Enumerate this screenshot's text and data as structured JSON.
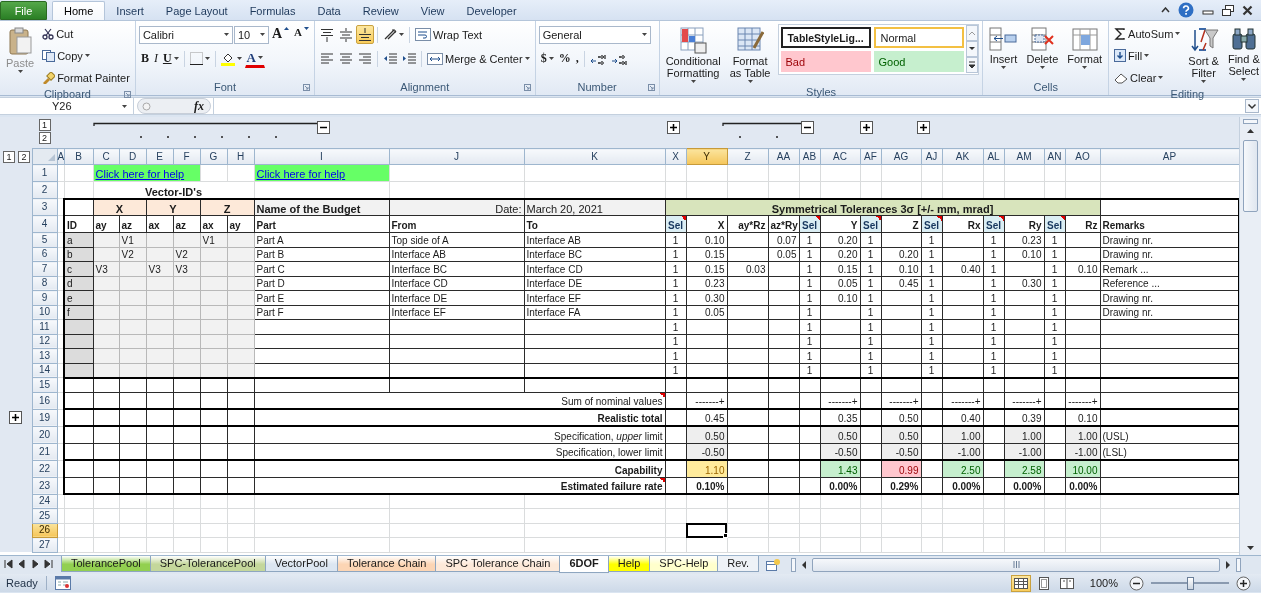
{
  "ribbon_tabs": [
    {
      "label": "File",
      "kind": "file",
      "selected": false
    },
    {
      "label": "Home",
      "kind": "tab",
      "selected": true
    },
    {
      "label": "Insert",
      "kind": "tab",
      "selected": false
    },
    {
      "label": "Page Layout",
      "kind": "tab",
      "selected": false
    },
    {
      "label": "Formulas",
      "kind": "tab",
      "selected": false
    },
    {
      "label": "Data",
      "kind": "tab",
      "selected": false
    },
    {
      "label": "Review",
      "kind": "tab",
      "selected": false
    },
    {
      "label": "View",
      "kind": "tab",
      "selected": false
    },
    {
      "label": "Developer",
      "kind": "tab",
      "selected": false
    }
  ],
  "ribbon": {
    "clipboard": {
      "label": "Clipboard",
      "paste": {
        "label": "Paste",
        "disabled": true
      },
      "cut": "Cut",
      "copy": "Copy",
      "format_painter": "Format Painter"
    },
    "font": {
      "label": "Font",
      "font_name": "Calibri",
      "font_size": "10",
      "grow": "A",
      "shrink": "A",
      "bold": "B",
      "italic": "I",
      "underline": "U",
      "font_color": "A"
    },
    "alignment": {
      "label": "Alignment",
      "vertical_align": [
        {
          "selected": false
        },
        {
          "selected": false
        },
        {
          "selected": true
        }
      ],
      "wrap_text": "Wrap Text",
      "merge_center": "Merge & Center"
    },
    "number": {
      "label": "Number",
      "format": "General",
      "currency": "$",
      "percent": "%",
      "comma": ","
    },
    "styles": {
      "label": "Styles",
      "conditional_formatting": "Conditional\nFormatting",
      "format_as_table": "Format\nas Table",
      "cell_styles": [
        {
          "text": "TableStyleLig...",
          "kind": "table"
        },
        {
          "text": "Normal",
          "kind": "normal"
        },
        {
          "text": "Bad",
          "kind": "bad"
        },
        {
          "text": "Good",
          "kind": "good"
        }
      ]
    },
    "cells": {
      "label": "Cells",
      "insert": "Insert",
      "delete": "Delete",
      "format": "Format"
    },
    "editing": {
      "label": "Editing",
      "autosum": "AutoSum",
      "fill": "Fill",
      "clear": "Clear",
      "sort_filter": "Sort &\nFilter",
      "find_select": "Find &\nSelect"
    }
  },
  "formula_bar": {
    "name_box": "Y26",
    "fx": "fx"
  },
  "outline": {
    "column_levels": [
      "1",
      "2"
    ],
    "row_levels": [
      "1",
      "2"
    ]
  },
  "columns": [
    {
      "label": "A",
      "selected": false
    },
    {
      "label": "B",
      "selected": false
    },
    {
      "label": "C",
      "selected": false
    },
    {
      "label": "D",
      "selected": false
    },
    {
      "label": "E",
      "selected": false
    },
    {
      "label": "F",
      "selected": false
    },
    {
      "label": "G",
      "selected": false
    },
    {
      "label": "H",
      "selected": false
    },
    {
      "label": "I",
      "selected": false
    },
    {
      "label": "J",
      "selected": false
    },
    {
      "label": "K",
      "selected": false
    },
    {
      "label": "X",
      "selected": false
    },
    {
      "label": "Y",
      "selected": true
    },
    {
      "label": "Z",
      "selected": false
    },
    {
      "label": "AA",
      "selected": false
    },
    {
      "label": "AB",
      "selected": false
    },
    {
      "label": "AC",
      "selected": false
    },
    {
      "label": "AF",
      "selected": false
    },
    {
      "label": "AG",
      "selected": false
    },
    {
      "label": "AJ",
      "selected": false
    },
    {
      "label": "AK",
      "selected": false
    },
    {
      "label": "AL",
      "selected": false
    },
    {
      "label": "AM",
      "selected": false
    },
    {
      "label": "AN",
      "selected": false
    },
    {
      "label": "AO",
      "selected": false
    },
    {
      "label": "AP",
      "selected": false
    }
  ],
  "rows": [
    {
      "label": "1",
      "selected": false,
      "group_collapsed": false,
      "cells": [
        {},
        {},
        {
          "kind": "link",
          "text": "Click here for help"
        },
        {
          "kind": "merged"
        },
        {
          "kind": "merged"
        },
        {
          "kind": "merged"
        },
        {},
        {},
        {
          "kind": "link",
          "text": "Click here for help"
        },
        {},
        {},
        {},
        {},
        {},
        {},
        {},
        {},
        {},
        {},
        {},
        {},
        {},
        {},
        {},
        {},
        {}
      ]
    },
    {
      "label": "2",
      "selected": false,
      "group_collapsed": false,
      "cells": [
        {},
        {},
        {
          "kind": "title",
          "text": "Vector-ID's"
        },
        {
          "kind": "merged"
        },
        {
          "kind": "merged"
        },
        {
          "kind": "merged"
        },
        {
          "kind": "merged"
        },
        {
          "kind": "merged"
        },
        {},
        {},
        {},
        {},
        {},
        {},
        {},
        {},
        {},
        {},
        {},
        {},
        {},
        {},
        {},
        {},
        {},
        {}
      ]
    },
    {
      "label": "3",
      "selected": false,
      "group_collapsed": false,
      "cells": [
        {},
        {},
        {
          "kind": "axis",
          "text": "X"
        },
        {
          "kind": "merged"
        },
        {
          "kind": "axis",
          "text": "Y"
        },
        {
          "kind": "merged"
        },
        {
          "kind": "axis",
          "text": "Z"
        },
        {
          "kind": "merged"
        },
        {
          "kind": "meta_bold",
          "text": "Name of the Budget"
        },
        {
          "kind": "meta_right",
          "text": "Date:"
        },
        {
          "kind": "meta",
          "text": "March 20, 2021"
        },
        {
          "kind": "band",
          "text": "Symmetrical Tolerances 3σ [+/- mm, mrad]"
        },
        {
          "kind": "merged"
        },
        {
          "kind": "merged"
        },
        {
          "kind": "merged"
        },
        {
          "kind": "merged"
        },
        {
          "kind": "merged"
        },
        {
          "kind": "merged"
        },
        {
          "kind": "merged"
        },
        {
          "kind": "merged"
        },
        {
          "kind": "merged"
        },
        {
          "kind": "merged"
        },
        {
          "kind": "merged"
        },
        {
          "kind": "merged"
        },
        {
          "kind": "merged"
        },
        {}
      ]
    },
    {
      "label": "4",
      "selected": false,
      "group_collapsed": false,
      "cells": [
        {},
        {
          "kind": "head",
          "text": "ID"
        },
        {
          "kind": "head",
          "text": "ay"
        },
        {
          "kind": "head",
          "text": "az"
        },
        {
          "kind": "head",
          "text": "ax"
        },
        {
          "kind": "head",
          "text": "az"
        },
        {
          "kind": "head",
          "text": "ax"
        },
        {
          "kind": "head",
          "text": "ay"
        },
        {
          "kind": "head",
          "text": "Part"
        },
        {
          "kind": "head",
          "text": "From"
        },
        {
          "kind": "head",
          "text": "To"
        },
        {
          "kind": "sel_head",
          "text": "Sel"
        },
        {
          "kind": "num_head",
          "text": "X"
        },
        {
          "kind": "num_head",
          "text": "ay*Rz"
        },
        {
          "kind": "num_head",
          "text": "az*Ry"
        },
        {
          "kind": "sel_head",
          "text": "Sel"
        },
        {
          "kind": "num_head",
          "text": "Y"
        },
        {
          "kind": "sel_head",
          "text": "Sel"
        },
        {
          "kind": "num_head",
          "text": "Z"
        },
        {
          "kind": "sel_head",
          "text": "Sel"
        },
        {
          "kind": "num_head",
          "text": "Rx"
        },
        {
          "kind": "sel_head",
          "text": "Sel"
        },
        {
          "kind": "num_head",
          "text": "Ry"
        },
        {
          "kind": "sel_head",
          "text": "Sel"
        },
        {
          "kind": "num_head",
          "text": "Rz"
        },
        {
          "kind": "head",
          "text": "Remarks"
        }
      ]
    },
    {
      "label": "5",
      "selected": false,
      "group_collapsed": false,
      "cells": [
        {},
        {
          "kind": "id",
          "text": "a"
        },
        {
          "kind": "input"
        },
        {
          "kind": "input",
          "text": "V1"
        },
        {
          "kind": "input"
        },
        {
          "kind": "input"
        },
        {
          "kind": "input",
          "text": "V1"
        },
        {
          "kind": "input"
        },
        {
          "kind": "text",
          "text": "Part A"
        },
        {
          "kind": "text",
          "text": "Top side of A"
        },
        {
          "kind": "text",
          "text": "Interface AB"
        },
        {
          "kind": "sel",
          "text": "1"
        },
        {
          "kind": "num",
          "text": "0.10"
        },
        {},
        {
          "kind": "num",
          "text": "0.07"
        },
        {
          "kind": "sel",
          "text": "1"
        },
        {
          "kind": "num",
          "text": "0.20"
        },
        {
          "kind": "sel",
          "text": "1"
        },
        {},
        {
          "kind": "sel",
          "text": "1"
        },
        {},
        {
          "kind": "sel",
          "text": "1"
        },
        {
          "kind": "num",
          "text": "0.23"
        },
        {
          "kind": "sel",
          "text": "1"
        },
        {},
        {
          "kind": "text",
          "text": "Drawing nr."
        }
      ]
    },
    {
      "label": "6",
      "selected": false,
      "group_collapsed": false,
      "cells": [
        {},
        {
          "kind": "id",
          "text": "b"
        },
        {
          "kind": "input"
        },
        {
          "kind": "input",
          "text": "V2"
        },
        {
          "kind": "input"
        },
        {
          "kind": "input",
          "text": "V2"
        },
        {
          "kind": "input"
        },
        {
          "kind": "input"
        },
        {
          "kind": "text",
          "text": "Part B"
        },
        {
          "kind": "text",
          "text": "Interface AB"
        },
        {
          "kind": "text",
          "text": "Interface BC"
        },
        {
          "kind": "sel",
          "text": "1"
        },
        {
          "kind": "num",
          "text": "0.15"
        },
        {},
        {
          "kind": "num",
          "text": "0.05"
        },
        {
          "kind": "sel",
          "text": "1"
        },
        {
          "kind": "num",
          "text": "0.20"
        },
        {
          "kind": "sel",
          "text": "1"
        },
        {
          "kind": "num",
          "text": "0.20"
        },
        {
          "kind": "sel",
          "text": "1"
        },
        {},
        {
          "kind": "sel",
          "text": "1"
        },
        {
          "kind": "num",
          "text": "0.10"
        },
        {
          "kind": "sel",
          "text": "1"
        },
        {},
        {
          "kind": "text",
          "text": "Drawing nr."
        }
      ]
    },
    {
      "label": "7",
      "selected": false,
      "group_collapsed": false,
      "cells": [
        {},
        {
          "kind": "id",
          "text": "c"
        },
        {
          "kind": "input",
          "text": "V3"
        },
        {
          "kind": "input"
        },
        {
          "kind": "input",
          "text": "V3"
        },
        {
          "kind": "input",
          "text": "V3"
        },
        {
          "kind": "input"
        },
        {
          "kind": "input"
        },
        {
          "kind": "text",
          "text": "Part C"
        },
        {
          "kind": "text",
          "text": "Interface BC"
        },
        {
          "kind": "text",
          "text": "Interface CD"
        },
        {
          "kind": "sel",
          "text": "1"
        },
        {
          "kind": "num",
          "text": "0.15"
        },
        {
          "kind": "num",
          "text": "0.03"
        },
        {},
        {
          "kind": "sel",
          "text": "1"
        },
        {
          "kind": "num",
          "text": "0.15"
        },
        {
          "kind": "sel",
          "text": "1"
        },
        {
          "kind": "num",
          "text": "0.10"
        },
        {
          "kind": "sel",
          "text": "1"
        },
        {
          "kind": "num",
          "text": "0.40"
        },
        {
          "kind": "sel",
          "text": "1"
        },
        {},
        {
          "kind": "sel",
          "text": "1"
        },
        {
          "kind": "num",
          "text": "0.10"
        },
        {
          "kind": "text",
          "text": "Remark ..."
        }
      ]
    },
    {
      "label": "8",
      "selected": false,
      "group_collapsed": false,
      "cells": [
        {},
        {
          "kind": "id",
          "text": "d"
        },
        {
          "kind": "input"
        },
        {
          "kind": "input"
        },
        {
          "kind": "input"
        },
        {
          "kind": "input"
        },
        {
          "kind": "input"
        },
        {
          "kind": "input"
        },
        {
          "kind": "text",
          "text": "Part D"
        },
        {
          "kind": "text",
          "text": "Interface CD"
        },
        {
          "kind": "text",
          "text": "Interface DE"
        },
        {
          "kind": "sel",
          "text": "1"
        },
        {
          "kind": "num",
          "text": "0.23"
        },
        {},
        {},
        {
          "kind": "sel",
          "text": "1"
        },
        {
          "kind": "num",
          "text": "0.05"
        },
        {
          "kind": "sel",
          "text": "1"
        },
        {
          "kind": "num",
          "text": "0.45"
        },
        {
          "kind": "sel",
          "text": "1"
        },
        {},
        {
          "kind": "sel",
          "text": "1"
        },
        {
          "kind": "num",
          "text": "0.30"
        },
        {
          "kind": "sel",
          "text": "1"
        },
        {},
        {
          "kind": "text",
          "text": "Reference ..."
        }
      ]
    },
    {
      "label": "9",
      "selected": false,
      "group_collapsed": false,
      "cells": [
        {},
        {
          "kind": "id",
          "text": "e"
        },
        {
          "kind": "input"
        },
        {
          "kind": "input"
        },
        {
          "kind": "input"
        },
        {
          "kind": "input"
        },
        {
          "kind": "input"
        },
        {
          "kind": "input"
        },
        {
          "kind": "text",
          "text": "Part E"
        },
        {
          "kind": "text",
          "text": "Interface DE"
        },
        {
          "kind": "text",
          "text": "Interface EF"
        },
        {
          "kind": "sel",
          "text": "1"
        },
        {
          "kind": "num",
          "text": "0.30"
        },
        {},
        {},
        {
          "kind": "sel",
          "text": "1"
        },
        {
          "kind": "num",
          "text": "0.10"
        },
        {
          "kind": "sel",
          "text": "1"
        },
        {},
        {
          "kind": "sel",
          "text": "1"
        },
        {},
        {
          "kind": "sel",
          "text": "1"
        },
        {},
        {
          "kind": "sel",
          "text": "1"
        },
        {},
        {
          "kind": "text",
          "text": "Drawing nr."
        }
      ]
    },
    {
      "label": "10",
      "selected": false,
      "group_collapsed": false,
      "cells": [
        {},
        {
          "kind": "id",
          "text": "f"
        },
        {
          "kind": "input"
        },
        {
          "kind": "input"
        },
        {
          "kind": "input"
        },
        {
          "kind": "input"
        },
        {
          "kind": "input"
        },
        {
          "kind": "input"
        },
        {
          "kind": "text",
          "text": "Part F"
        },
        {
          "kind": "text",
          "text": "Interface EF"
        },
        {
          "kind": "text",
          "text": "Interface FA"
        },
        {
          "kind": "sel",
          "text": "1"
        },
        {
          "kind": "num",
          "text": "0.05"
        },
        {},
        {},
        {
          "kind": "sel",
          "text": "1"
        },
        {},
        {
          "kind": "sel",
          "text": "1"
        },
        {},
        {
          "kind": "sel",
          "text": "1"
        },
        {},
        {
          "kind": "sel",
          "text": "1"
        },
        {},
        {
          "kind": "sel",
          "text": "1"
        },
        {},
        {
          "kind": "text",
          "text": "Drawing nr."
        }
      ]
    },
    {
      "label": "11",
      "selected": false,
      "group_collapsed": false,
      "cells": [
        {},
        {
          "kind": "id"
        },
        {
          "kind": "input"
        },
        {
          "kind": "input"
        },
        {
          "kind": "input"
        },
        {
          "kind": "input"
        },
        {
          "kind": "input"
        },
        {
          "kind": "input"
        },
        {},
        {},
        {},
        {
          "kind": "sel",
          "text": "1"
        },
        {},
        {},
        {},
        {
          "kind": "sel",
          "text": "1"
        },
        {},
        {
          "kind": "sel",
          "text": "1"
        },
        {},
        {
          "kind": "sel",
          "text": "1"
        },
        {},
        {
          "kind": "sel",
          "text": "1"
        },
        {},
        {
          "kind": "sel",
          "text": "1"
        },
        {},
        {}
      ]
    },
    {
      "label": "12",
      "selected": false,
      "group_collapsed": false,
      "cells": [
        {},
        {
          "kind": "id"
        },
        {
          "kind": "input"
        },
        {
          "kind": "input"
        },
        {
          "kind": "input"
        },
        {
          "kind": "input"
        },
        {
          "kind": "input"
        },
        {
          "kind": "input"
        },
        {},
        {},
        {},
        {
          "kind": "sel",
          "text": "1"
        },
        {},
        {},
        {},
        {
          "kind": "sel",
          "text": "1"
        },
        {},
        {
          "kind": "sel",
          "text": "1"
        },
        {},
        {
          "kind": "sel",
          "text": "1"
        },
        {},
        {
          "kind": "sel",
          "text": "1"
        },
        {},
        {
          "kind": "sel",
          "text": "1"
        },
        {},
        {}
      ]
    },
    {
      "label": "13",
      "selected": false,
      "group_collapsed": false,
      "cells": [
        {},
        {
          "kind": "id"
        },
        {
          "kind": "input"
        },
        {
          "kind": "input"
        },
        {
          "kind": "input"
        },
        {
          "kind": "input"
        },
        {
          "kind": "input"
        },
        {
          "kind": "input"
        },
        {},
        {},
        {},
        {
          "kind": "sel",
          "text": "1"
        },
        {},
        {},
        {},
        {
          "kind": "sel",
          "text": "1"
        },
        {},
        {
          "kind": "sel",
          "text": "1"
        },
        {},
        {
          "kind": "sel",
          "text": "1"
        },
        {},
        {
          "kind": "sel",
          "text": "1"
        },
        {},
        {
          "kind": "sel",
          "text": "1"
        },
        {},
        {}
      ]
    },
    {
      "label": "14",
      "selected": false,
      "group_collapsed": false,
      "cells": [
        {},
        {
          "kind": "id"
        },
        {
          "kind": "input"
        },
        {
          "kind": "input"
        },
        {
          "kind": "input"
        },
        {
          "kind": "input"
        },
        {
          "kind": "input"
        },
        {
          "kind": "input"
        },
        {},
        {},
        {},
        {
          "kind": "sel",
          "text": "1"
        },
        {},
        {},
        {},
        {
          "kind": "sel",
          "text": "1"
        },
        {},
        {
          "kind": "sel",
          "text": "1"
        },
        {},
        {
          "kind": "sel",
          "text": "1"
        },
        {},
        {
          "kind": "sel",
          "text": "1"
        },
        {},
        {
          "kind": "sel",
          "text": "1"
        },
        {},
        {}
      ]
    },
    {
      "label": "15",
      "selected": false,
      "group_collapsed": false,
      "cells": [
        {},
        {},
        {},
        {},
        {},
        {},
        {},
        {},
        {},
        {},
        {},
        {},
        {},
        {},
        {},
        {},
        {},
        {},
        {},
        {},
        {},
        {},
        {},
        {},
        {},
        {}
      ]
    },
    {
      "label": "16",
      "selected": false,
      "group_collapsed": false,
      "cells": [
        {},
        {},
        {},
        {},
        {},
        {},
        {},
        {},
        {
          "kind": "label_comment",
          "text": "Sum of nominal values"
        },
        {
          "kind": "merged"
        },
        {
          "kind": "merged"
        },
        {},
        {
          "kind": "dash",
          "text": "-------+"
        },
        {},
        {},
        {},
        {
          "kind": "dash",
          "text": "-------+"
        },
        {},
        {
          "kind": "dash",
          "text": "-------+"
        },
        {},
        {
          "kind": "dash",
          "text": "-------+"
        },
        {},
        {
          "kind": "dash",
          "text": "-------+"
        },
        {},
        {
          "kind": "dash",
          "text": "-------+"
        },
        {}
      ]
    },
    {
      "label": "19",
      "selected": false,
      "group_collapsed": true,
      "cells": [
        {},
        {},
        {},
        {},
        {},
        {},
        {},
        {},
        {
          "kind": "strong_label",
          "text": "Realistic total"
        },
        {
          "kind": "merged"
        },
        {
          "kind": "merged"
        },
        {},
        {
          "kind": "num",
          "text": "0.45"
        },
        {},
        {},
        {},
        {
          "kind": "num",
          "text": "0.35"
        },
        {},
        {
          "kind": "num",
          "text": "0.50"
        },
        {},
        {
          "kind": "num",
          "text": "0.40"
        },
        {},
        {
          "kind": "num",
          "text": "0.39"
        },
        {},
        {
          "kind": "num",
          "text": "0.10"
        },
        {}
      ]
    },
    {
      "label": "20",
      "selected": false,
      "group_collapsed": false,
      "cells": [
        {},
        {},
        {},
        {},
        {},
        {},
        {},
        {},
        {
          "kind": "label",
          "text": "Specification, *upper* limit"
        },
        {
          "kind": "merged"
        },
        {
          "kind": "merged"
        },
        {},
        {
          "kind": "spec",
          "text": "0.50"
        },
        {},
        {},
        {},
        {
          "kind": "spec",
          "text": "0.50"
        },
        {},
        {
          "kind": "spec",
          "text": "0.50"
        },
        {},
        {
          "kind": "spec",
          "text": "1.00"
        },
        {},
        {
          "kind": "spec",
          "text": "1.00"
        },
        {},
        {
          "kind": "spec",
          "text": "1.00"
        },
        {
          "kind": "text",
          "text": "(USL)"
        }
      ]
    },
    {
      "label": "21",
      "selected": false,
      "group_collapsed": false,
      "cells": [
        {},
        {},
        {},
        {},
        {},
        {},
        {},
        {},
        {
          "kind": "label",
          "text": "Specification, lower limit"
        },
        {
          "kind": "merged"
        },
        {
          "kind": "merged"
        },
        {},
        {
          "kind": "spec",
          "text": "-0.50"
        },
        {},
        {},
        {},
        {
          "kind": "spec",
          "text": "-0.50"
        },
        {},
        {
          "kind": "spec",
          "text": "-0.50"
        },
        {},
        {
          "kind": "spec",
          "text": "-1.00"
        },
        {},
        {
          "kind": "spec",
          "text": "-1.00"
        },
        {},
        {
          "kind": "spec",
          "text": "-1.00"
        },
        {
          "kind": "text",
          "text": "(LSL)"
        }
      ]
    },
    {
      "label": "22",
      "selected": false,
      "group_collapsed": false,
      "cells": [
        {},
        {},
        {},
        {},
        {},
        {},
        {},
        {},
        {
          "kind": "strong_label",
          "text": "Capability"
        },
        {
          "kind": "merged"
        },
        {
          "kind": "merged"
        },
        {},
        {
          "kind": "cap_neutral",
          "text": "1.10"
        },
        {},
        {},
        {},
        {
          "kind": "cap_good",
          "text": "1.43"
        },
        {},
        {
          "kind": "cap_bad",
          "text": "0.99"
        },
        {},
        {
          "kind": "cap_good",
          "text": "2.50"
        },
        {},
        {
          "kind": "cap_good",
          "text": "2.58"
        },
        {},
        {
          "kind": "cap_good",
          "text": "10.00"
        },
        {}
      ]
    },
    {
      "label": "23",
      "selected": false,
      "group_collapsed": false,
      "cells": [
        {},
        {},
        {},
        {},
        {},
        {},
        {},
        {},
        {
          "kind": "strong_label_comment",
          "text": "Estimated failure rate"
        },
        {
          "kind": "merged"
        },
        {
          "kind": "merged"
        },
        {},
        {
          "kind": "pct",
          "text": "0.10%"
        },
        {},
        {},
        {},
        {
          "kind": "pct",
          "text": "0.00%"
        },
        {},
        {
          "kind": "pct",
          "text": "0.29%"
        },
        {},
        {
          "kind": "pct",
          "text": "0.00%"
        },
        {},
        {
          "kind": "pct",
          "text": "0.00%"
        },
        {},
        {
          "kind": "pct",
          "text": "0.00%"
        },
        {}
      ]
    },
    {
      "label": "24",
      "selected": false,
      "group_collapsed": false,
      "cells": [
        {},
        {},
        {},
        {},
        {},
        {},
        {},
        {},
        {},
        {},
        {},
        {},
        {},
        {},
        {},
        {},
        {},
        {},
        {},
        {},
        {},
        {},
        {},
        {},
        {},
        {}
      ]
    },
    {
      "label": "25",
      "selected": false,
      "group_collapsed": false,
      "cells": [
        {},
        {},
        {},
        {},
        {},
        {},
        {},
        {},
        {},
        {},
        {},
        {},
        {},
        {},
        {},
        {},
        {},
        {},
        {},
        {},
        {},
        {},
        {},
        {},
        {},
        {}
      ]
    },
    {
      "label": "26",
      "selected": true,
      "group_collapsed": false,
      "cells": [
        {},
        {},
        {},
        {},
        {},
        {},
        {},
        {},
        {},
        {},
        {},
        {},
        {
          "kind": "active"
        },
        {},
        {},
        {},
        {},
        {},
        {},
        {},
        {},
        {},
        {},
        {},
        {},
        {}
      ]
    },
    {
      "label": "27",
      "selected": false,
      "group_collapsed": false,
      "cells": [
        {},
        {},
        {},
        {},
        {},
        {},
        {},
        {},
        {},
        {},
        {},
        {},
        {},
        {},
        {},
        {},
        {},
        {},
        {},
        {},
        {},
        {},
        {},
        {},
        {},
        {}
      ]
    }
  ],
  "sheet_tabs": [
    {
      "label": "TolerancePool",
      "selected": false,
      "color": "#92d050"
    },
    {
      "label": "SPC-TolerancePool",
      "selected": false,
      "color": "#c4d79b"
    },
    {
      "label": "VectorPool",
      "selected": false,
      "color": "#dce6f1"
    },
    {
      "label": "Tolerance Chain",
      "selected": false,
      "color": "#fcd5b4"
    },
    {
      "label": "SPC Tolerance Chain",
      "selected": false,
      "color": "#fde9d9"
    },
    {
      "label": "6DOF",
      "selected": true
    },
    {
      "label": "Help",
      "selected": false,
      "color": "#ffff00"
    },
    {
      "label": "SPC-Help",
      "selected": false,
      "color": "#ffffcc"
    },
    {
      "label": "Rev.",
      "selected": false
    }
  ],
  "status_bar": {
    "text": "Ready",
    "views": [
      {
        "selected": true
      },
      {
        "selected": false
      },
      {
        "selected": false
      }
    ],
    "zoom": "100%",
    "zoom_slider": {
      "level": 0.5
    }
  }
}
